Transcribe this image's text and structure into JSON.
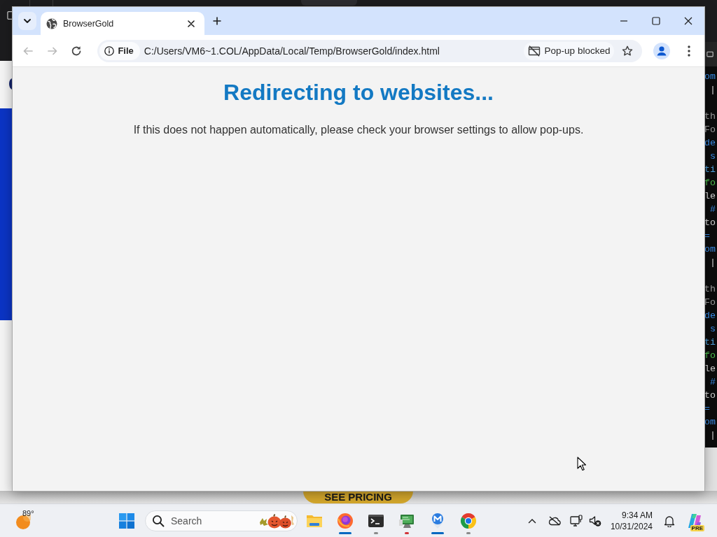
{
  "desktop": {
    "terminal": {
      "blocks": [
        {
          "lines": [
            {
              "text": "om",
              "kind": "keyword"
            },
            {
              "text": " |",
              "kind": "plain"
            }
          ]
        },
        {
          "lines": [
            {
              "text": "th",
              "kind": "comment"
            },
            {
              "text": "Fo",
              "kind": "comment"
            },
            {
              "text": "de",
              "kind": "keyword"
            },
            {
              "text": " s",
              "kind": "keyword"
            },
            {
              "text": "ti",
              "kind": "type"
            },
            {
              "text": "fo",
              "kind": "string"
            },
            {
              "text": "le",
              "kind": "plain"
            },
            {
              "text": " #",
              "kind": "keyword"
            },
            {
              "text": "to",
              "kind": "plain"
            },
            {
              "text": "=",
              "kind": "keyword"
            },
            {
              "text": "om",
              "kind": "keyword"
            },
            {
              "text": " |",
              "kind": "plain"
            }
          ]
        },
        {
          "lines": [
            {
              "text": "th",
              "kind": "comment"
            },
            {
              "text": "Fo",
              "kind": "comment"
            },
            {
              "text": "de",
              "kind": "keyword"
            },
            {
              "text": " s",
              "kind": "keyword"
            },
            {
              "text": "ti",
              "kind": "type"
            },
            {
              "text": "fo",
              "kind": "string"
            },
            {
              "text": "le",
              "kind": "plain"
            },
            {
              "text": " #",
              "kind": "keyword"
            },
            {
              "text": "to",
              "kind": "plain"
            },
            {
              "text": "=",
              "kind": "keyword"
            },
            {
              "text": "om",
              "kind": "keyword"
            },
            {
              "text": " |",
              "kind": "plain"
            }
          ]
        }
      ]
    },
    "promo_button": "SEE PRICING"
  },
  "browser": {
    "tabs": [
      {
        "title": "BrowserGold",
        "selected": true
      }
    ],
    "nav": [
      {
        "kind": "back",
        "disabled": true
      },
      {
        "kind": "forward",
        "disabled": true
      },
      {
        "kind": "reload",
        "disabled": false
      }
    ],
    "address_bar": {
      "site_label": "File",
      "url": "C:/Users/VM6~1.COL/AppData/Local/Temp/BrowserGold/index.html",
      "notice": "Pop-up blocked"
    }
  },
  "page": {
    "heading": "Redirecting to websites...",
    "message": "If this does not happen automatically, please check your browser settings to allow pop-ups."
  },
  "taskbar": {
    "weather": "89°",
    "search": {
      "placeholder": "Search"
    },
    "apps": [
      {
        "kind": "explorer",
        "open": false,
        "active": false,
        "attention": false
      },
      {
        "kind": "firefox",
        "open": true,
        "active": true,
        "attention": false
      },
      {
        "kind": "terminal",
        "open": true,
        "active": false,
        "attention": false
      },
      {
        "kind": "monitor",
        "open": true,
        "active": false,
        "attention": true
      },
      {
        "kind": "shield",
        "open": true,
        "active": true,
        "attention": false
      },
      {
        "kind": "chrome",
        "open": true,
        "active": false,
        "attention": false
      }
    ],
    "clock": {
      "time": "9:34 AM",
      "date": "10/31/2024"
    },
    "copilot_badge": "PRE"
  }
}
